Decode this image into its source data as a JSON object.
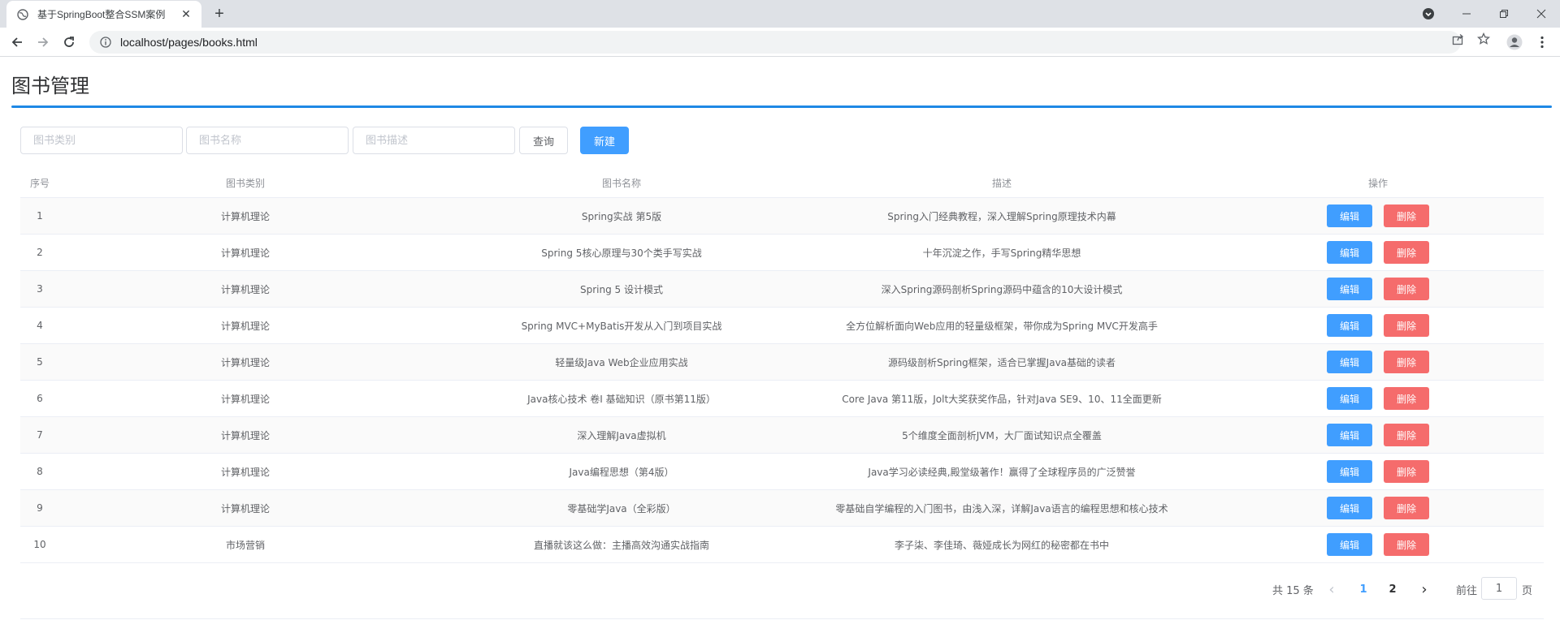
{
  "browser": {
    "tab_title": "基于SpringBoot整合SSM案例",
    "url": "localhost/pages/books.html",
    "new_tab": "+",
    "close_tab": "✕"
  },
  "page": {
    "title": "图书管理",
    "accent_color": "#1e88e5"
  },
  "filters": {
    "type_placeholder": "图书类别",
    "name_placeholder": "图书名称",
    "desc_placeholder": "图书描述",
    "query_label": "查询",
    "new_label": "新建"
  },
  "table": {
    "headers": {
      "index": "序号",
      "type": "图书类别",
      "name": "图书名称",
      "description": "描述",
      "actions": "操作"
    },
    "edit_label": "编辑",
    "delete_label": "删除",
    "rows": [
      {
        "index": "1",
        "type": "计算机理论",
        "name": "Spring实战 第5版",
        "description": "Spring入门经典教程，深入理解Spring原理技术内幕"
      },
      {
        "index": "2",
        "type": "计算机理论",
        "name": "Spring 5核心原理与30个类手写实战",
        "description": "十年沉淀之作，手写Spring精华思想"
      },
      {
        "index": "3",
        "type": "计算机理论",
        "name": "Spring 5 设计模式",
        "description": "深入Spring源码剖析Spring源码中蕴含的10大设计模式"
      },
      {
        "index": "4",
        "type": "计算机理论",
        "name": "Spring MVC+MyBatis开发从入门到项目实战",
        "description": "全方位解析面向Web应用的轻量级框架，带你成为Spring MVC开发高手"
      },
      {
        "index": "5",
        "type": "计算机理论",
        "name": "轻量级Java Web企业应用实战",
        "description": "源码级剖析Spring框架，适合已掌握Java基础的读者"
      },
      {
        "index": "6",
        "type": "计算机理论",
        "name": "Java核心技术 卷I 基础知识（原书第11版）",
        "description": "Core Java 第11版，Jolt大奖获奖作品，针对Java SE9、10、11全面更新"
      },
      {
        "index": "7",
        "type": "计算机理论",
        "name": "深入理解Java虚拟机",
        "description": "5个维度全面剖析JVM，大厂面试知识点全覆盖"
      },
      {
        "index": "8",
        "type": "计算机理论",
        "name": "Java编程思想（第4版）",
        "description": "Java学习必读经典,殿堂级著作！赢得了全球程序员的广泛赞誉"
      },
      {
        "index": "9",
        "type": "计算机理论",
        "name": "零基础学Java（全彩版）",
        "description": "零基础自学编程的入门图书，由浅入深，详解Java语言的编程思想和核心技术"
      },
      {
        "index": "10",
        "type": "市场营销",
        "name": "直播就该这么做：主播高效沟通实战指南",
        "description": "李子柒、李佳琦、薇娅成长为网红的秘密都在书中"
      }
    ]
  },
  "pagination": {
    "total_text": "共 15 条",
    "prev": "‹",
    "pages": [
      "1",
      "2"
    ],
    "current_page": "1",
    "next": "›",
    "goto_prefix": "前往",
    "goto_value": "1",
    "goto_suffix": "页"
  }
}
